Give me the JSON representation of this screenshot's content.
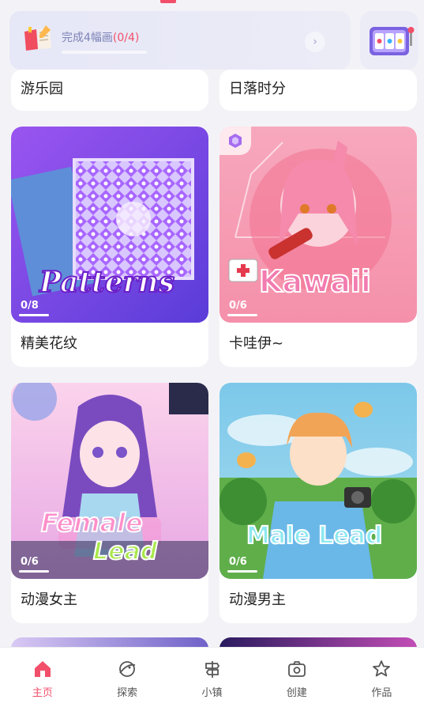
{
  "task": {
    "text": "完成4幅画",
    "count": "(0/4)"
  },
  "cards": {
    "amusement": {
      "title": "游乐园"
    },
    "sunset": {
      "title": "日落时分"
    },
    "patterns": {
      "title": "精美花纹",
      "art_text": "Patterns",
      "progress": "0/8"
    },
    "kawaii": {
      "title": "卡哇伊~",
      "art_text": "Kawaii",
      "progress": "0/6"
    },
    "female": {
      "title": "动漫女主",
      "art_text_1": "Female",
      "art_text_2": "Lead",
      "progress": "0/6"
    },
    "male": {
      "title": "动漫男主",
      "art_text": "Male Lead",
      "progress": "0/6"
    }
  },
  "tabs": [
    {
      "label": "主页",
      "icon": "home-icon",
      "active": true
    },
    {
      "label": "探索",
      "icon": "explore-icon"
    },
    {
      "label": "小镇",
      "icon": "town-icon"
    },
    {
      "label": "创建",
      "icon": "camera-icon"
    },
    {
      "label": "作品",
      "icon": "star-icon"
    }
  ],
  "colors": {
    "accent": "#f24f6a",
    "background": "#f3f3f7",
    "task_text": "#7d82b6"
  }
}
